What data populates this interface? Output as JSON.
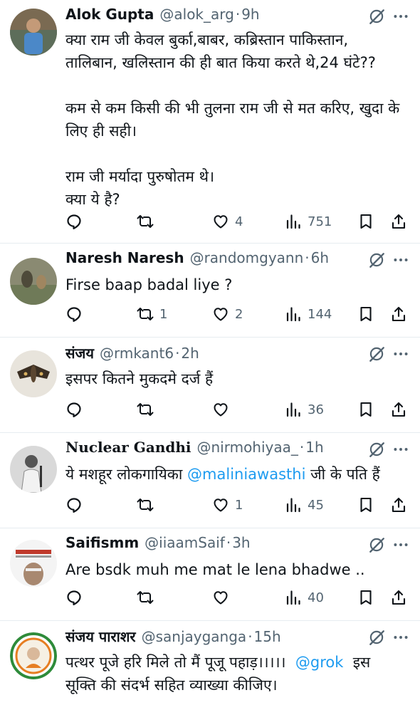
{
  "tweets": [
    {
      "name": "Alok Gupta",
      "handle": "@alok_arg",
      "time": "9h",
      "text_lines": [
        "क्या राम जी केवल बुर्का,बाबर, कब्रिस्तान पाकिस्तान,",
        "तालिबान, खलिस्तान की ही बात किया करते थे,24 घंटे??",
        "",
        "कम से कम किसी की भी तुलना राम जी से मत करिए, खुदा के",
        "लिए ही सही।",
        "",
        "राम जी मर्यादा पुरुषोतम थे।",
        "क्या ये है?"
      ],
      "replies": "",
      "reposts": "",
      "likes": "4",
      "views": "751"
    },
    {
      "name": "Naresh Naresh",
      "handle": "@randomgyann",
      "time": "6h",
      "text_lines": [
        "Firse baap badal liye ?"
      ],
      "replies": "",
      "reposts": "1",
      "likes": "2",
      "views": "144"
    },
    {
      "name": "संजय",
      "handle": "@rmkant6",
      "time": "2h",
      "text_lines": [
        "इसपर कितने मुकदमे दर्ज हैं"
      ],
      "replies": "",
      "reposts": "",
      "likes": "",
      "views": "36"
    },
    {
      "name": "Nuclear Gandhi",
      "handle": "@nirmohiyaa_",
      "time": "1h",
      "text_before_mention": "ये मशहूर लोकगायिका ",
      "mention": "@maliniawasthi",
      "text_after_mention": " जी के पति हैं",
      "replies": "",
      "reposts": "",
      "likes": "1",
      "views": "45"
    },
    {
      "name": "Saifismm",
      "handle": "@iiaamSaif",
      "time": "3h",
      "text_lines": [
        "Are bsdk muh me mat le lena bhadwe .."
      ],
      "replies": "",
      "reposts": "",
      "likes": "",
      "views": "40"
    },
    {
      "name": "संजय पाराशर",
      "handle": "@sanjayganga",
      "time": "15h",
      "text_before_mention": "पत्थर पूजे हरि मिले तो मैं पूजू पहाड़।।।।।  ",
      "mention": "@grok",
      "text_after_mention": "  इस",
      "text_line2": "सूक्ति की संदर्भ सहित व्याख्या कीजिए।"
    }
  ],
  "colors": {
    "text": "#0f1419",
    "muted": "#536471",
    "link": "#1d9bf0",
    "divider": "#e6ecf0"
  },
  "icons": [
    "reply-icon",
    "repost-icon",
    "like-icon",
    "views-icon",
    "bookmark-icon",
    "share-icon",
    "grok-icon",
    "more-icon"
  ]
}
